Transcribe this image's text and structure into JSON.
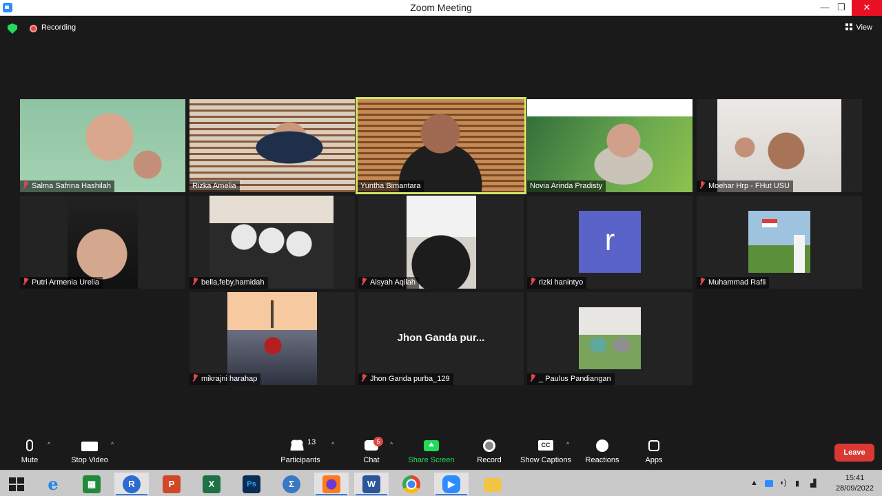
{
  "window": {
    "title": "Zoom Meeting",
    "min": "—",
    "max": "❐",
    "close": "✕"
  },
  "topbar": {
    "recording_label": "Recording",
    "view_label": "View"
  },
  "participants": [
    {
      "name": "Salma Safrina Hashilah",
      "muted": true
    },
    {
      "name": "Rizka Amelia",
      "muted": false
    },
    {
      "name": "Yuntha Bimantara",
      "muted": false,
      "active_speaker": true
    },
    {
      "name": "Novia Arinda Pradisty",
      "muted": false
    },
    {
      "name": "Moehar Hrp - FHut USU",
      "muted": true
    },
    {
      "name": "Putri Armenia Urelia",
      "muted": true
    },
    {
      "name": "bella,feby,hamidah",
      "muted": true
    },
    {
      "name": "Aisyah Aqilah",
      "muted": true
    },
    {
      "name": "rizki hanintyo",
      "muted": true,
      "avatar_letter": "r"
    },
    {
      "name": "Muhammad Rafli",
      "muted": true
    },
    {
      "name": "mikrajni harahap",
      "muted": true
    },
    {
      "name": "Jhon Ganda purba_129",
      "muted": true,
      "display_text": "Jhon Ganda pur..."
    },
    {
      "name": "_ Paulus Pandiangan",
      "muted": true
    }
  ],
  "toolbar": {
    "mute": "Mute",
    "stop_video": "Stop Video",
    "participants": "Participants",
    "participants_count": "13",
    "chat": "Chat",
    "chat_badge": "5",
    "share_screen": "Share Screen",
    "record": "Record",
    "show_captions": "Show Captions",
    "reactions": "Reactions",
    "apps": "Apps",
    "leave": "Leave",
    "captions_icon": "CC"
  },
  "taskbar": {
    "apps": [
      "windows-start",
      "internet-explorer",
      "windows-store",
      "r-language",
      "powerpoint",
      "excel",
      "photoshop",
      "math-input",
      "firefox",
      "word",
      "chrome",
      "zoom",
      "file-explorer"
    ],
    "r_glyph": "R",
    "ps_glyph": "Ps",
    "w_glyph": "W",
    "time": "15:41",
    "date": "28/09/2022"
  },
  "colors": {
    "accent_green": "#23d959",
    "leave_red": "#d93833",
    "active_border": "#d5e66a",
    "zoom_blue": "#2d8cff"
  }
}
